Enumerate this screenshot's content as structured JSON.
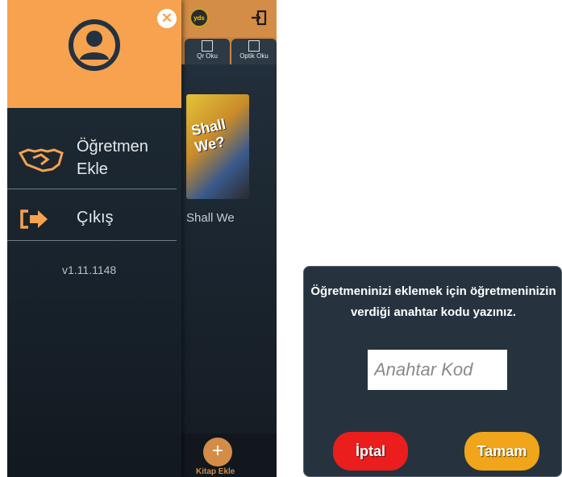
{
  "colors": {
    "accent_orange": "#f6a24f",
    "drawer_bg": "#1f2c37",
    "dialog_bg": "#26333f",
    "cancel_red": "#ec1d1d",
    "ok_orange": "#f0a51a"
  },
  "background_app": {
    "logo_text": "yds",
    "tabs": [
      {
        "label": "Qr Oku",
        "icon": "qr-icon"
      },
      {
        "label": "Optik Oku",
        "icon": "optical-scan-icon"
      }
    ],
    "book_title": "Shall We",
    "book_cover_text": "Shall We?",
    "add_book_label": "Kitap Ekle"
  },
  "drawer": {
    "avatar_icon": "user-avatar-icon",
    "close_icon": "close-icon",
    "items": [
      {
        "label_line1": "Öğretmen",
        "label_line2": "Ekle",
        "icon": "handshake-icon"
      },
      {
        "label": "Çıkış",
        "icon": "sign-out-icon"
      }
    ],
    "version": "v1.11.1148"
  },
  "dialog": {
    "message_line1": "Öğretmeninizi eklemek için öğretmeninizin",
    "message_line2": "verdiği anahtar kodu yazınız.",
    "input_placeholder": "Anahtar Kod",
    "input_value": "",
    "cancel_label": "İptal",
    "ok_label": "Tamam"
  }
}
